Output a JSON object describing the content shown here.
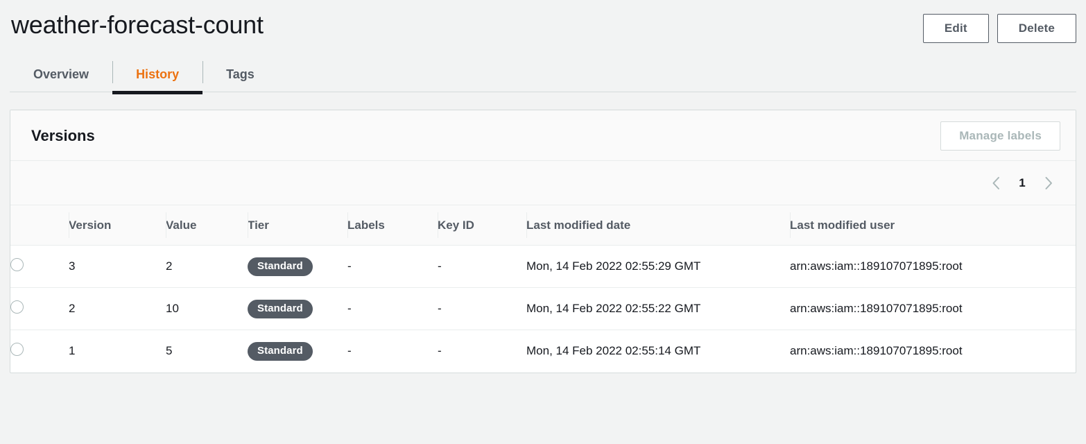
{
  "header": {
    "title": "weather-forecast-count",
    "actions": [
      {
        "label": "Edit",
        "name": "edit-button"
      },
      {
        "label": "Delete",
        "name": "delete-button"
      }
    ]
  },
  "tabs": [
    {
      "label": "Overview",
      "active": false
    },
    {
      "label": "History",
      "active": true
    },
    {
      "label": "Tags",
      "active": false
    }
  ],
  "card": {
    "title": "Versions",
    "manage_labels_label": "Manage labels",
    "pagination": {
      "prev_icon": "chevron-left-icon",
      "page": "1",
      "next_icon": "chevron-right-icon"
    },
    "columns": [
      "Version",
      "Value",
      "Tier",
      "Labels",
      "Key ID",
      "Last modified date",
      "Last modified user"
    ],
    "rows": [
      {
        "version": "3",
        "value": "2",
        "tier": "Standard",
        "labels": "-",
        "key_id": "-",
        "last_modified_date": "Mon, 14 Feb 2022 02:55:29 GMT",
        "last_modified_user": "arn:aws:iam::189107071895:root"
      },
      {
        "version": "2",
        "value": "10",
        "tier": "Standard",
        "labels": "-",
        "key_id": "-",
        "last_modified_date": "Mon, 14 Feb 2022 02:55:22 GMT",
        "last_modified_user": "arn:aws:iam::189107071895:root"
      },
      {
        "version": "1",
        "value": "5",
        "tier": "Standard",
        "labels": "-",
        "key_id": "-",
        "last_modified_date": "Mon, 14 Feb 2022 02:55:14 GMT",
        "last_modified_user": "arn:aws:iam::189107071895:root"
      }
    ]
  },
  "colors": {
    "accent": "#ec7211",
    "badge": "#545b64",
    "page_bg": "#f2f3f3",
    "border": "#d5dbdb"
  }
}
